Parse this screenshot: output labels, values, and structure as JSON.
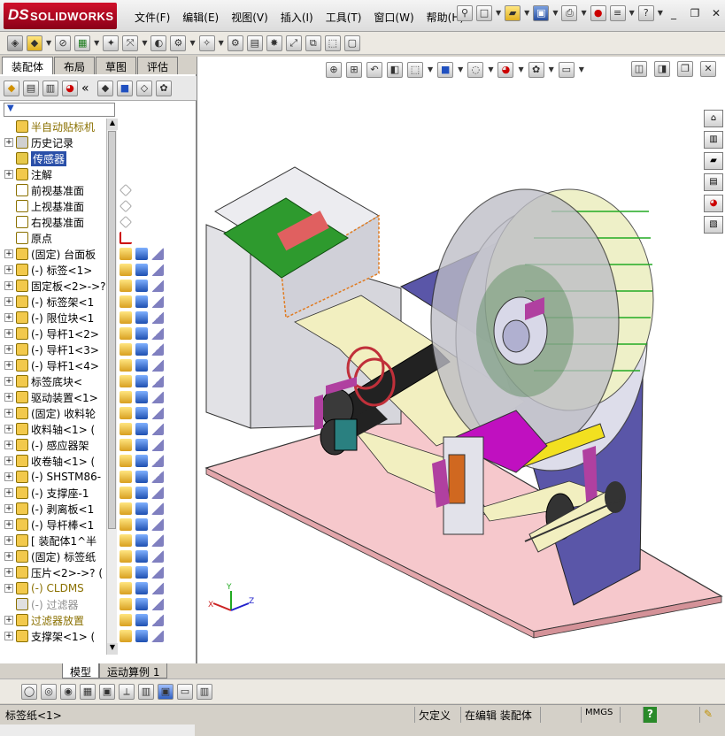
{
  "app": {
    "logo_ds": "DS",
    "logo_name": "SOLIDWORKS",
    "menu": [
      "文件(F)",
      "编辑(E)",
      "视图(V)",
      "插入(I)",
      "工具(T)",
      "窗口(W)",
      "帮助(H)"
    ]
  },
  "tabs": [
    "装配体",
    "布局",
    "草图",
    "评估"
  ],
  "active_tab": "装配体",
  "tree": {
    "root": "半自动贴标机",
    "items": [
      {
        "label": "历史记录",
        "exp": "+",
        "icon": "history-icon",
        "color": "#d0d0d0"
      },
      {
        "label": "传感器",
        "exp": "",
        "icon": "sensor-icon",
        "color": "#e6c84a",
        "selected": true
      },
      {
        "label": "注解",
        "exp": "+",
        "icon": "annotation-icon",
        "color": "#f2c94c"
      },
      {
        "label": "前视基准面",
        "exp": "",
        "icon": "plane-icon",
        "color": "#ffffff"
      },
      {
        "label": "上视基准面",
        "exp": "",
        "icon": "plane-icon",
        "color": "#ffffff"
      },
      {
        "label": "右视基准面",
        "exp": "",
        "icon": "plane-icon",
        "color": "#ffffff"
      },
      {
        "label": "原点",
        "exp": "",
        "icon": "origin-icon",
        "color": "#ffffff"
      },
      {
        "label": "(固定) 台面板",
        "exp": "+",
        "icon": "part-icon",
        "color": "#f2c94c"
      },
      {
        "label": "(-) 标签<1>",
        "exp": "+",
        "icon": "part-icon",
        "color": "#f2c94c"
      },
      {
        "label": "固定板<2>->?",
        "exp": "+",
        "icon": "part-icon",
        "color": "#f2c94c"
      },
      {
        "label": "(-) 标签架<1",
        "exp": "+",
        "icon": "part-icon",
        "color": "#f2c94c"
      },
      {
        "label": "(-) 限位块<1",
        "exp": "+",
        "icon": "part-icon",
        "color": "#f2c94c"
      },
      {
        "label": "(-) 导杆1<2>",
        "exp": "+",
        "icon": "part-icon",
        "color": "#f2c94c"
      },
      {
        "label": "(-) 导杆1<3>",
        "exp": "+",
        "icon": "part-icon",
        "color": "#f2c94c"
      },
      {
        "label": "(-) 导杆1<4>",
        "exp": "+",
        "icon": "part-icon",
        "color": "#f2c94c"
      },
      {
        "label": "标签底块<",
        "exp": "+",
        "icon": "part-icon",
        "color": "#f2c94c"
      },
      {
        "label": "驱动装置<1>",
        "exp": "+",
        "icon": "assembly-icon",
        "color": "#f2c94c"
      },
      {
        "label": "(固定) 收料轮",
        "exp": "+",
        "icon": "part-icon",
        "color": "#f2c94c"
      },
      {
        "label": "收料轴<1> (",
        "exp": "+",
        "icon": "part-icon",
        "color": "#f2c94c"
      },
      {
        "label": "(-) 感应器架",
        "exp": "+",
        "icon": "part-icon",
        "color": "#f2c94c"
      },
      {
        "label": "收卷轴<1> (",
        "exp": "+",
        "icon": "part-icon",
        "color": "#f2c94c"
      },
      {
        "label": "(-) SHSTM86-",
        "exp": "+",
        "icon": "part-icon",
        "color": "#f2c94c"
      },
      {
        "label": "(-) 支撑座-1",
        "exp": "+",
        "icon": "part-icon",
        "color": "#f2c94c"
      },
      {
        "label": "(-) 剥离板<1",
        "exp": "+",
        "icon": "part-icon",
        "color": "#f2c94c"
      },
      {
        "label": "(-) 导杆棒<1",
        "exp": "+",
        "icon": "part-icon",
        "color": "#f2c94c"
      },
      {
        "label": "[ 装配体1^半",
        "exp": "+",
        "icon": "assembly-icon",
        "color": "#f2c94c"
      },
      {
        "label": "(固定) 标签纸",
        "exp": "+",
        "icon": "part-icon",
        "color": "#f2c94c"
      },
      {
        "label": "压片<2>->? (",
        "exp": "+",
        "icon": "part-icon",
        "color": "#f2c94c"
      },
      {
        "label": "(-) CLDMS",
        "exp": "+",
        "icon": "warning-icon",
        "color": "#f2c94c",
        "warn": true
      },
      {
        "label": "(-) 过滤器",
        "exp": "",
        "icon": "warning-icon",
        "color": "#e0e0e0",
        "dim": true
      },
      {
        "label": "过滤器放置",
        "exp": "+",
        "icon": "warning-icon",
        "color": "#f2c94c",
        "warn": true
      },
      {
        "label": "支撑架<1> (",
        "exp": "+",
        "icon": "part-icon",
        "color": "#f2c94c"
      }
    ]
  },
  "bottom_tabs": [
    "模型",
    "运动算例 1"
  ],
  "active_bottom_tab": "模型",
  "status": {
    "left": "标签纸<1>",
    "under_defined": "欠定义",
    "editing": "在编辑 装配体",
    "units": "MMGS",
    "help": "?"
  },
  "axis": {
    "x": "X",
    "y": "Y",
    "z": "Z"
  },
  "colors": {
    "accent_red": "#c8102e",
    "selection_blue": "#2a4fa8",
    "floor_pink": "#f6c8cc",
    "wall_purple": "#5a56a8",
    "label_yellow": "#f2efc0"
  }
}
